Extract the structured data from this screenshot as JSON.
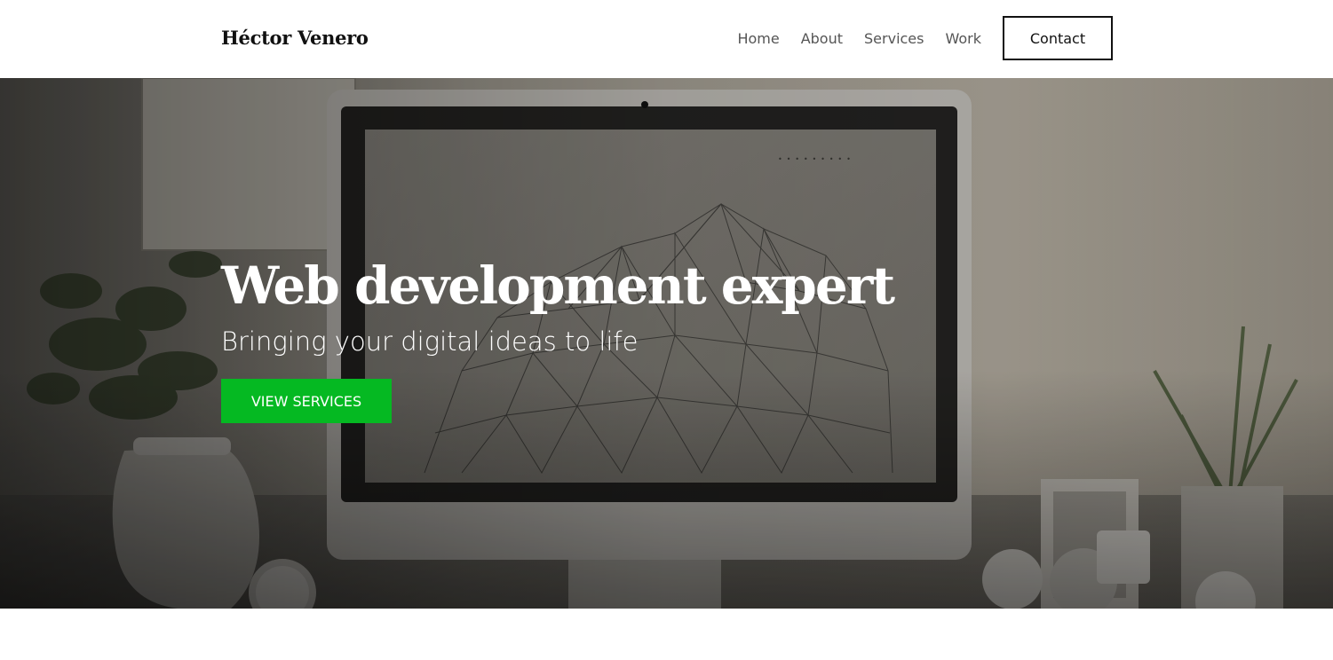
{
  "header": {
    "logo": "Héctor Venero",
    "nav": {
      "home": "Home",
      "about": "About",
      "services": "Services",
      "work": "Work",
      "contact": "Contact"
    }
  },
  "hero": {
    "title": "Web development expert",
    "subtitle": "Bringing your digital ideas to life",
    "button": "VIEW SERVICES",
    "screen_text": "• • • • • • • • •"
  },
  "colors": {
    "accent": "#05b922",
    "logo": "#111111",
    "nav_text": "#555555"
  }
}
